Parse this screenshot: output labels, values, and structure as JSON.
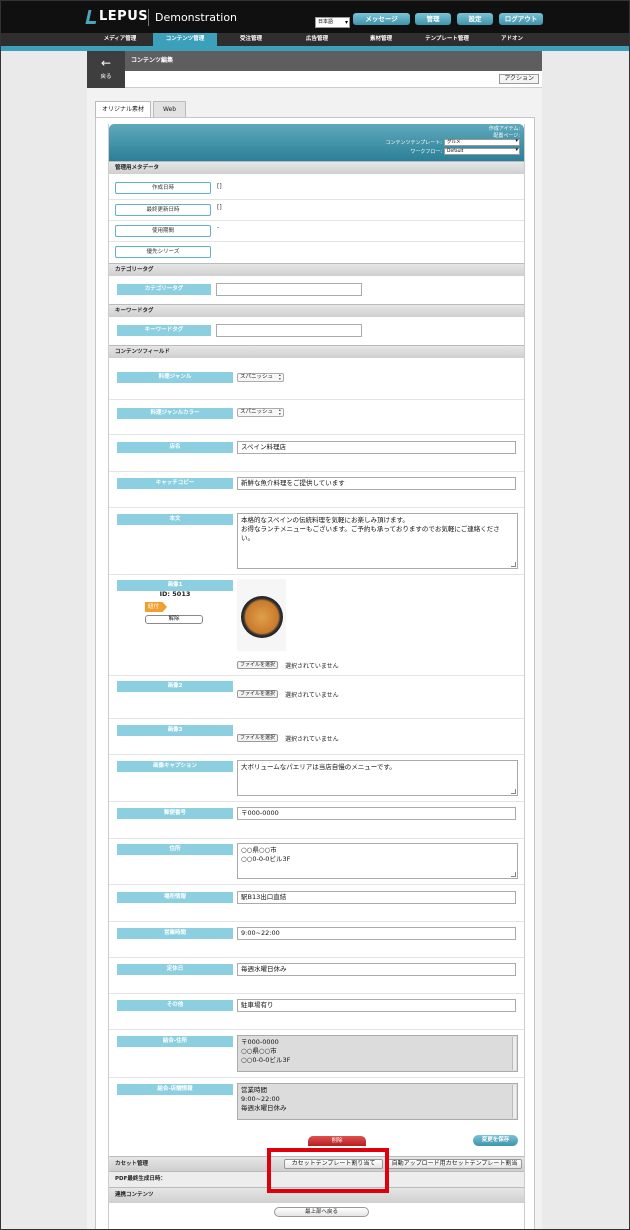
{
  "header": {
    "logo": "LEPUS",
    "app_title": "Demonstration",
    "language": "日本語",
    "buttons": {
      "message": "メッセージ",
      "manage": "管理",
      "settings": "設定",
      "logout": "ログアウト"
    }
  },
  "nav": [
    "メディア管理",
    "コンテンツ管理",
    "受注管理",
    "広告管理",
    "素材管理",
    "テンプレート管理",
    "アドオン"
  ],
  "page": {
    "back_label": "戻る",
    "title": "コンテンツ編集",
    "action_button": "アクション",
    "tabs": [
      "オリジナル素材",
      "Web"
    ]
  },
  "panel_head": {
    "line1": "作成アイテム:",
    "line2": "配置ページ:",
    "template_label": "コンテンツテンプレート:",
    "template_value": "グルメ",
    "workflow_label": "ワークフロー:",
    "workflow_value": "Default"
  },
  "sections": {
    "meta": "管理用メタデータ",
    "category": "カテゴリータグ",
    "keyword": "キーワードタグ",
    "fields": "コンテンツフィールド",
    "cassette": "カセット管理",
    "pdf": "PDF最終生成日時：",
    "related": "連携コンテンツ"
  },
  "meta": {
    "created_label": "作成日時",
    "created_value": "[]",
    "updated_label": "最終更新日時",
    "updated_value": "[]",
    "period_label": "使用期間",
    "period_value": "-",
    "priority_label": "優先シリーズ"
  },
  "tags": {
    "category_label": "カテゴリータグ",
    "keyword_label": "キーワードタグ"
  },
  "fields": {
    "genre_label": "料理ジャンル",
    "genre_value": "スパニッシュ",
    "genre_color_label": "料理ジャンルカラー",
    "genre_color_value": "スパニッシュ",
    "shop_label": "店名",
    "shop_value": "スペイン料理店",
    "catch_label": "キャッチコピー",
    "catch_value": "新鮮な魚介料理をご提供しています",
    "body_label": "本文",
    "body_line1": "本格的なスペインの伝統料理を気軽にお楽しみ頂けます。",
    "body_line2": "お得なランチメニューもございます。ご予約も承っておりますのでお気軽にご連絡くださ",
    "body_line3": "い。",
    "image1_label": "画像1",
    "image1_id": "ID: 5013",
    "image1_badge": "紐付",
    "image1_unlink": "解除",
    "file_button": "ファイルを選択",
    "file_none": "選択されていません",
    "image2_label": "画像2",
    "image3_label": "画像3",
    "caption_label": "画像キャプション",
    "caption_value": "大ボリュームなパエリアは当店自慢のメニューです。",
    "zip_label": "郵便番号",
    "zip_value": "〒000-0000",
    "address_label": "住所",
    "address_line1": "○○県○○市",
    "address_line2": "○○0-0-0ビル3F",
    "place_label": "場所情報",
    "place_value": "駅B13出口直結",
    "hours_label": "営業時間",
    "hours_value": "9:00~22:00",
    "holiday_label": "定休日",
    "holiday_value": "毎週水曜日休み",
    "other_label": "その他",
    "other_value": "駐車場有り",
    "combined_addr_label": "結合-住所",
    "combined_addr_line1": "〒000-0000",
    "combined_addr_line2": "○○県○○市",
    "combined_addr_line3": "○○0-0-0ビル3F",
    "combined_shop_label": "結合-店舗情報",
    "combined_shop_line1": "営業時間",
    "combined_shop_line2": "9:00~22:00",
    "combined_shop_line3": "毎週水曜日休み"
  },
  "footer": {
    "delete_button": "削除",
    "save_button": "変更を保存",
    "cassette_assign_button": "カセットテンプレート割り当て",
    "auto_upload_button": "自動アップロード用カセットテンプレート割当",
    "to_top_button": "最上部へ戻る"
  },
  "colors": {
    "accent": "#3da0bb",
    "highlight": "#e0000b",
    "label": "#8ccfe0"
  }
}
